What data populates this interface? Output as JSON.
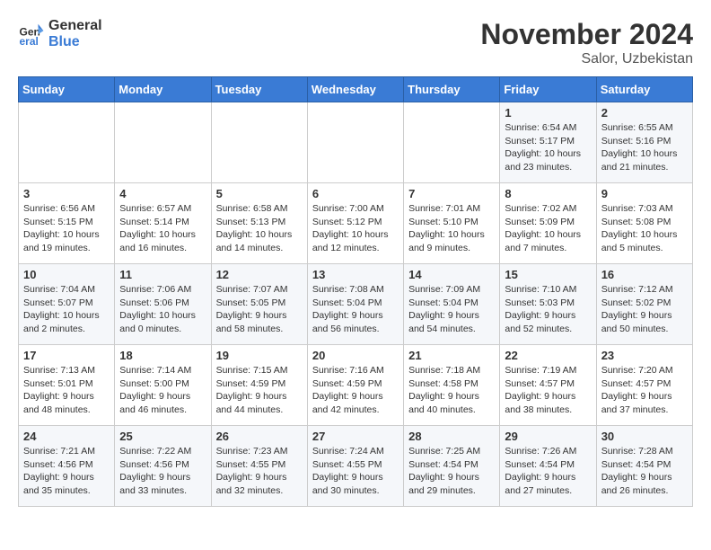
{
  "logo": {
    "line1": "General",
    "line2": "Blue"
  },
  "title": "November 2024",
  "location": "Salor, Uzbekistan",
  "weekdays": [
    "Sunday",
    "Monday",
    "Tuesday",
    "Wednesday",
    "Thursday",
    "Friday",
    "Saturday"
  ],
  "weeks": [
    [
      {
        "day": "",
        "info": ""
      },
      {
        "day": "",
        "info": ""
      },
      {
        "day": "",
        "info": ""
      },
      {
        "day": "",
        "info": ""
      },
      {
        "day": "",
        "info": ""
      },
      {
        "day": "1",
        "info": "Sunrise: 6:54 AM\nSunset: 5:17 PM\nDaylight: 10 hours\nand 23 minutes."
      },
      {
        "day": "2",
        "info": "Sunrise: 6:55 AM\nSunset: 5:16 PM\nDaylight: 10 hours\nand 21 minutes."
      }
    ],
    [
      {
        "day": "3",
        "info": "Sunrise: 6:56 AM\nSunset: 5:15 PM\nDaylight: 10 hours\nand 19 minutes."
      },
      {
        "day": "4",
        "info": "Sunrise: 6:57 AM\nSunset: 5:14 PM\nDaylight: 10 hours\nand 16 minutes."
      },
      {
        "day": "5",
        "info": "Sunrise: 6:58 AM\nSunset: 5:13 PM\nDaylight: 10 hours\nand 14 minutes."
      },
      {
        "day": "6",
        "info": "Sunrise: 7:00 AM\nSunset: 5:12 PM\nDaylight: 10 hours\nand 12 minutes."
      },
      {
        "day": "7",
        "info": "Sunrise: 7:01 AM\nSunset: 5:10 PM\nDaylight: 10 hours\nand 9 minutes."
      },
      {
        "day": "8",
        "info": "Sunrise: 7:02 AM\nSunset: 5:09 PM\nDaylight: 10 hours\nand 7 minutes."
      },
      {
        "day": "9",
        "info": "Sunrise: 7:03 AM\nSunset: 5:08 PM\nDaylight: 10 hours\nand 5 minutes."
      }
    ],
    [
      {
        "day": "10",
        "info": "Sunrise: 7:04 AM\nSunset: 5:07 PM\nDaylight: 10 hours\nand 2 minutes."
      },
      {
        "day": "11",
        "info": "Sunrise: 7:06 AM\nSunset: 5:06 PM\nDaylight: 10 hours\nand 0 minutes."
      },
      {
        "day": "12",
        "info": "Sunrise: 7:07 AM\nSunset: 5:05 PM\nDaylight: 9 hours\nand 58 minutes."
      },
      {
        "day": "13",
        "info": "Sunrise: 7:08 AM\nSunset: 5:04 PM\nDaylight: 9 hours\nand 56 minutes."
      },
      {
        "day": "14",
        "info": "Sunrise: 7:09 AM\nSunset: 5:04 PM\nDaylight: 9 hours\nand 54 minutes."
      },
      {
        "day": "15",
        "info": "Sunrise: 7:10 AM\nSunset: 5:03 PM\nDaylight: 9 hours\nand 52 minutes."
      },
      {
        "day": "16",
        "info": "Sunrise: 7:12 AM\nSunset: 5:02 PM\nDaylight: 9 hours\nand 50 minutes."
      }
    ],
    [
      {
        "day": "17",
        "info": "Sunrise: 7:13 AM\nSunset: 5:01 PM\nDaylight: 9 hours\nand 48 minutes."
      },
      {
        "day": "18",
        "info": "Sunrise: 7:14 AM\nSunset: 5:00 PM\nDaylight: 9 hours\nand 46 minutes."
      },
      {
        "day": "19",
        "info": "Sunrise: 7:15 AM\nSunset: 4:59 PM\nDaylight: 9 hours\nand 44 minutes."
      },
      {
        "day": "20",
        "info": "Sunrise: 7:16 AM\nSunset: 4:59 PM\nDaylight: 9 hours\nand 42 minutes."
      },
      {
        "day": "21",
        "info": "Sunrise: 7:18 AM\nSunset: 4:58 PM\nDaylight: 9 hours\nand 40 minutes."
      },
      {
        "day": "22",
        "info": "Sunrise: 7:19 AM\nSunset: 4:57 PM\nDaylight: 9 hours\nand 38 minutes."
      },
      {
        "day": "23",
        "info": "Sunrise: 7:20 AM\nSunset: 4:57 PM\nDaylight: 9 hours\nand 37 minutes."
      }
    ],
    [
      {
        "day": "24",
        "info": "Sunrise: 7:21 AM\nSunset: 4:56 PM\nDaylight: 9 hours\nand 35 minutes."
      },
      {
        "day": "25",
        "info": "Sunrise: 7:22 AM\nSunset: 4:56 PM\nDaylight: 9 hours\nand 33 minutes."
      },
      {
        "day": "26",
        "info": "Sunrise: 7:23 AM\nSunset: 4:55 PM\nDaylight: 9 hours\nand 32 minutes."
      },
      {
        "day": "27",
        "info": "Sunrise: 7:24 AM\nSunset: 4:55 PM\nDaylight: 9 hours\nand 30 minutes."
      },
      {
        "day": "28",
        "info": "Sunrise: 7:25 AM\nSunset: 4:54 PM\nDaylight: 9 hours\nand 29 minutes."
      },
      {
        "day": "29",
        "info": "Sunrise: 7:26 AM\nSunset: 4:54 PM\nDaylight: 9 hours\nand 27 minutes."
      },
      {
        "day": "30",
        "info": "Sunrise: 7:28 AM\nSunset: 4:54 PM\nDaylight: 9 hours\nand 26 minutes."
      }
    ]
  ]
}
